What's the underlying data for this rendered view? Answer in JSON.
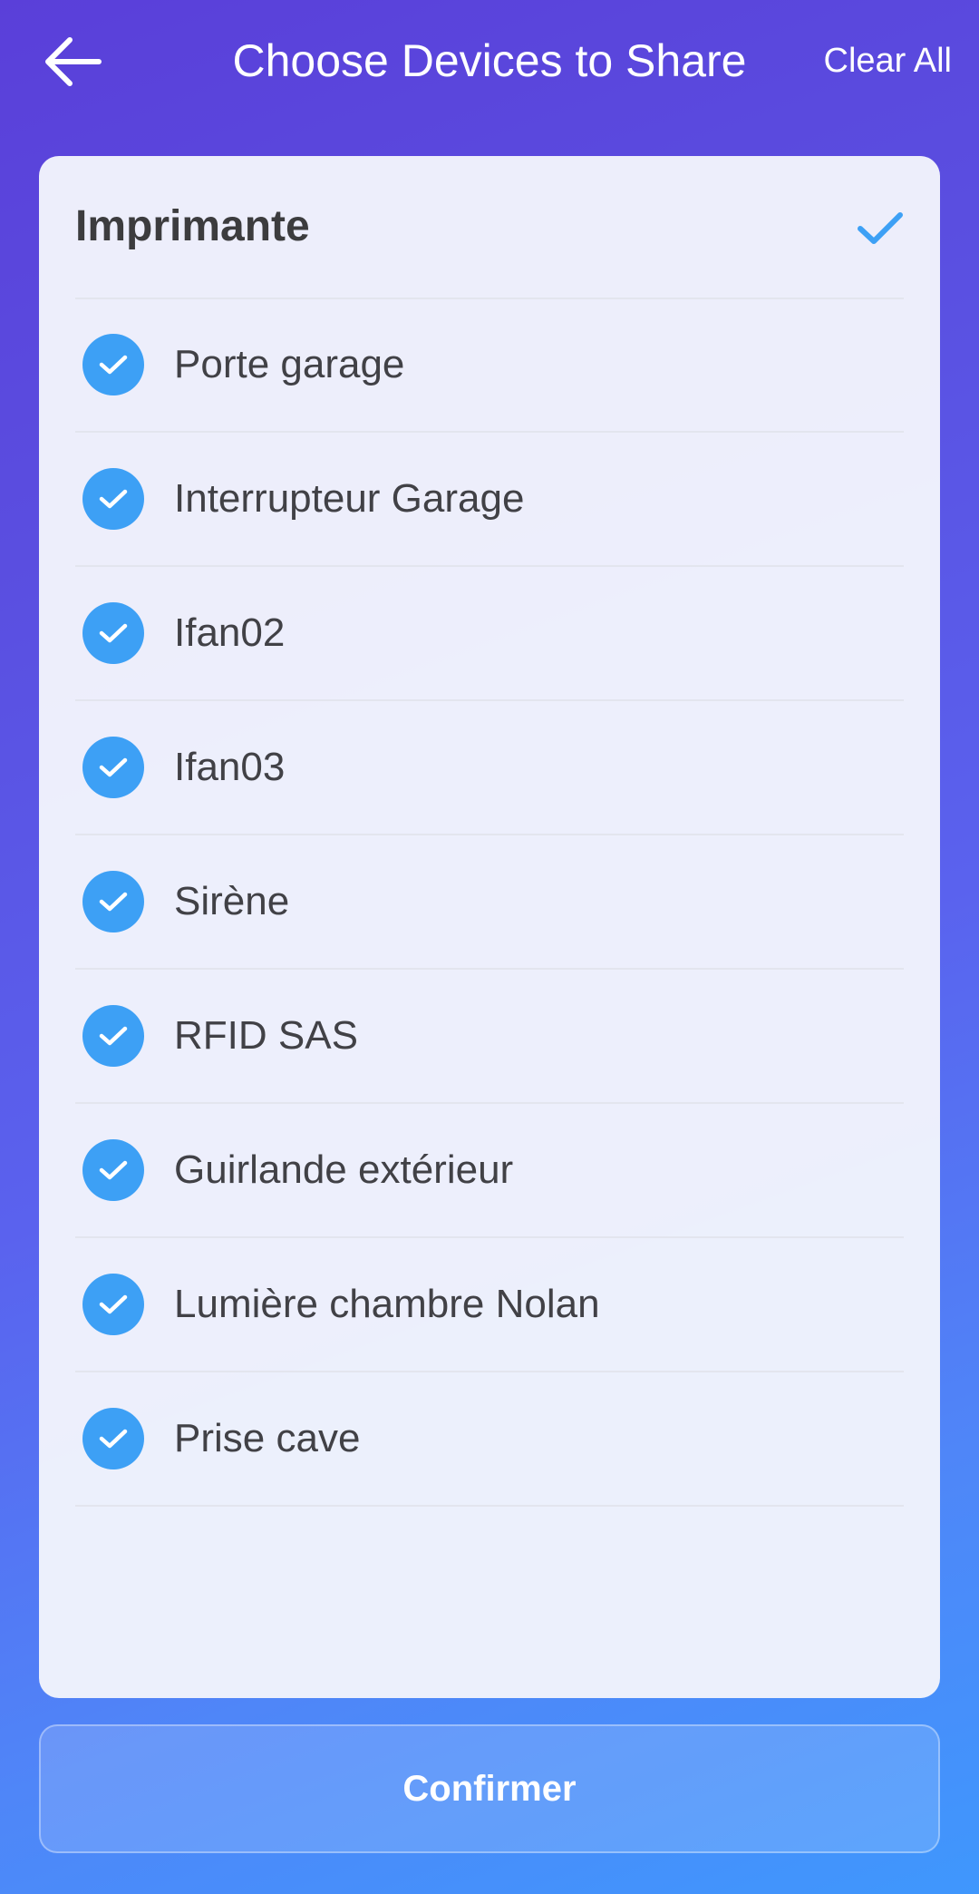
{
  "header": {
    "title": "Choose Devices to Share",
    "clear_all_label": "Clear All",
    "back_icon": "arrow-left-icon"
  },
  "group": {
    "title": "Imprimante",
    "selected": true,
    "check_icon": "checkmark-icon"
  },
  "devices": [
    {
      "label": "Porte garage",
      "selected": true
    },
    {
      "label": "Interrupteur Garage",
      "selected": true
    },
    {
      "label": "Ifan02",
      "selected": true
    },
    {
      "label": "Ifan03",
      "selected": true
    },
    {
      "label": "Sirène",
      "selected": true
    },
    {
      "label": "RFID SAS",
      "selected": true
    },
    {
      "label": "Guirlande extérieur",
      "selected": true
    },
    {
      "label": "Lumière chambre Nolan",
      "selected": true
    },
    {
      "label": "Prise cave",
      "selected": true
    }
  ],
  "confirm_label": "Confirmer",
  "colors": {
    "accent": "#3da0f5",
    "background_top": "#5a3fd9",
    "background_bottom": "#3f97fd"
  }
}
